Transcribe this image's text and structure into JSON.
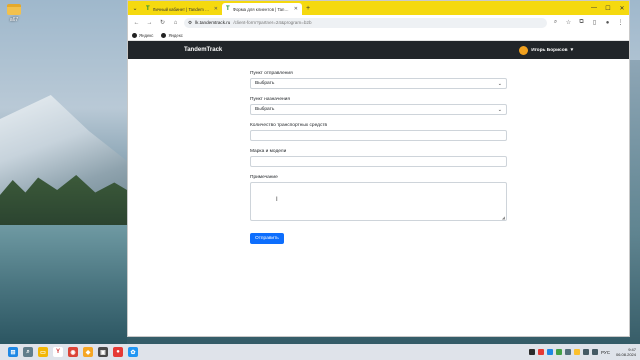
{
  "desktop": {
    "icon_label": "a67"
  },
  "browser": {
    "tabs": [
      {
        "title": "Личный кабинет | Tandem Tr...",
        "active": false
      },
      {
        "title": "Форма для клиентов | Tandem...",
        "active": true
      }
    ],
    "address": {
      "host": "lk.tandemtrack.ru",
      "path": "/client-form?partner=24&program=b2b"
    },
    "bookmarks": [
      {
        "label": "Яндекс"
      },
      {
        "label": "Яндекс"
      }
    ]
  },
  "app": {
    "brand": "TandemTrack",
    "user_name": "Игорь Борисов"
  },
  "form": {
    "departure": {
      "label": "Пункт отправления",
      "value": "Выбрать"
    },
    "destination": {
      "label": "Пункт назначения",
      "value": "Выбрать"
    },
    "vehicle_count": {
      "label": "Количество транспортных средств",
      "value": ""
    },
    "make_model": {
      "label": "Марка и модели",
      "value": ""
    },
    "notes": {
      "label": "Примечание",
      "value": ""
    },
    "submit_label": "Отправить"
  },
  "taskbar": {
    "apps": [
      {
        "name": "start-icon",
        "color": "#1e88e5",
        "glyph": "⊞"
      },
      {
        "name": "search-icon",
        "color": "#607d8b",
        "glyph": "⌕"
      },
      {
        "name": "file-explorer-icon",
        "color": "#f2b705",
        "glyph": "▭"
      },
      {
        "name": "yandex-browser-icon",
        "color": "#ffffff",
        "glyph": "Y"
      },
      {
        "name": "chrome-icon",
        "color": "#db4437",
        "glyph": "◉"
      },
      {
        "name": "app-icon-1",
        "color": "#f5a623",
        "glyph": "◆"
      },
      {
        "name": "app-icon-2",
        "color": "#4a4a4a",
        "glyph": "▣"
      },
      {
        "name": "app-icon-3",
        "color": "#e53935",
        "glyph": "●"
      },
      {
        "name": "app-icon-4",
        "color": "#2196f3",
        "glyph": "✿"
      }
    ],
    "lang": "РУС",
    "time": "9:47",
    "date": "06.08.2024"
  }
}
